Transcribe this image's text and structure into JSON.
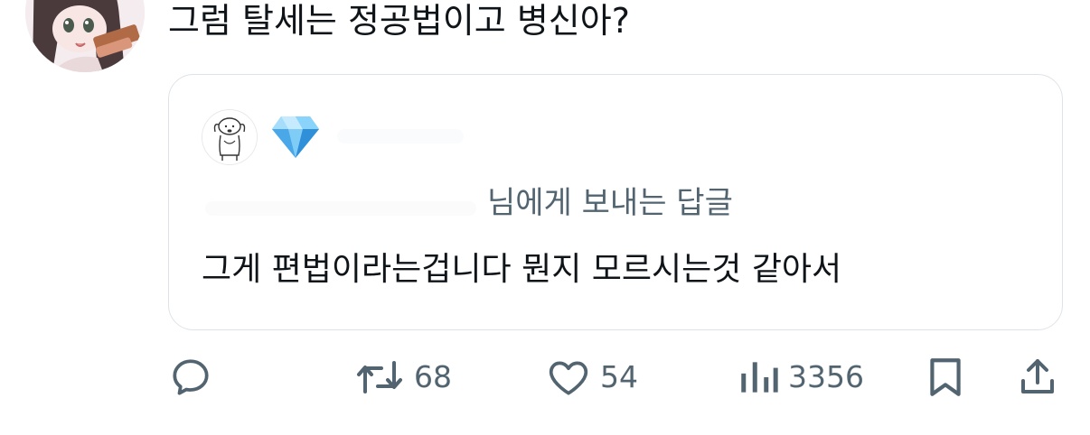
{
  "tweet": {
    "text": "그럼 탈세는 정공법이고 병신아?"
  },
  "quote": {
    "badge_icon": "diamond-icon",
    "reply_to": "님에게 보내는 답글",
    "text": "그게 편법이라는겁니다 뭔지 모르시는것 같아서"
  },
  "actions": {
    "reply_icon": "reply-icon",
    "retweet_icon": "retweet-icon",
    "retweet_count": "68",
    "like_icon": "heart-icon",
    "like_count": "54",
    "views_icon": "views-icon",
    "views_count": "3356",
    "bookmark_icon": "bookmark-icon",
    "share_icon": "share-icon"
  },
  "colors": {
    "text_primary": "#0f1419",
    "text_secondary": "#536471",
    "border": "#dfe3e8",
    "diamond": "#4fb3f2"
  }
}
